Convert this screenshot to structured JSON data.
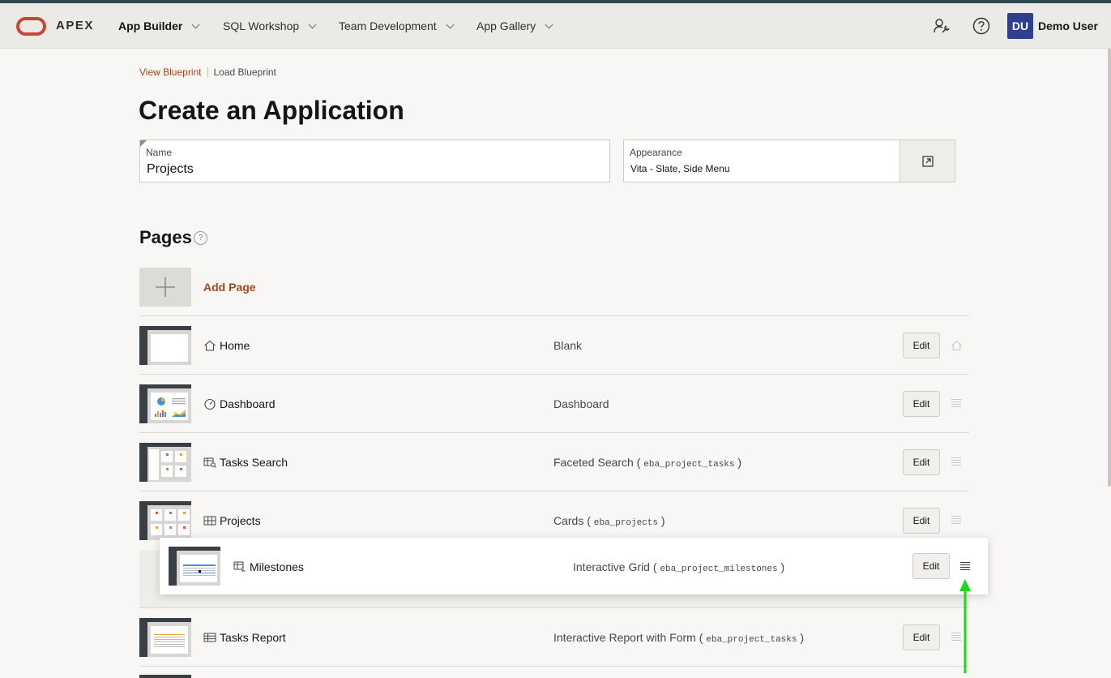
{
  "header": {
    "brand": "APEX",
    "nav": [
      {
        "label": "App Builder"
      },
      {
        "label": "SQL Workshop"
      },
      {
        "label": "Team Development"
      },
      {
        "label": "App Gallery"
      }
    ],
    "user_initials": "DU",
    "user_name": "Demo User",
    "icons": [
      "admin-wrench-icon",
      "help-icon"
    ]
  },
  "breadcrumbs": {
    "link": "View Blueprint",
    "current": "Load Blueprint"
  },
  "page_title": "Create an Application",
  "name_field": {
    "label": "Name",
    "value": "Projects"
  },
  "appearance_field": {
    "label": "Appearance",
    "value": "Vita - Slate, Side Menu"
  },
  "pages": {
    "title": "Pages",
    "help": "?",
    "add_label": "Add Page",
    "rows": [
      {
        "name": "Home",
        "type": "Blank",
        "table": "",
        "icon": "home-icon",
        "edit": "Edit",
        "trailing": "home-icon"
      },
      {
        "name": "Dashboard",
        "type": "Dashboard",
        "table": "",
        "icon": "dashboard-icon",
        "edit": "Edit",
        "trailing": "drag-handle-icon"
      },
      {
        "name": "Tasks Search",
        "type": "Faceted Search (",
        "table": "eba_project_tasks",
        "close": ")",
        "icon": "faceted-search-icon",
        "edit": "Edit",
        "trailing": "drag-handle-icon"
      },
      {
        "name": "Projects",
        "type": "Cards (",
        "table": "eba_projects",
        "close": ")",
        "icon": "cards-icon",
        "edit": "Edit",
        "trailing": "drag-handle-icon"
      },
      {
        "name": "Tasks Report",
        "type": "Interactive Report with Form (",
        "table": "eba_project_tasks",
        "close": ")",
        "icon": "report-icon",
        "edit": "Edit",
        "trailing": "drag-handle-icon"
      }
    ],
    "dragging": {
      "name": "Milestones",
      "type": "Interactive Grid (",
      "table": "eba_project_milestones",
      "close": ")",
      "icon": "grid-icon",
      "edit": "Edit",
      "trailing": "drag-handle-icon"
    }
  },
  "colors": {
    "accent": "#a8451f",
    "brand_red": "#c74634",
    "avatar": "#2f3f8e",
    "arrow": "#1bd81b"
  }
}
